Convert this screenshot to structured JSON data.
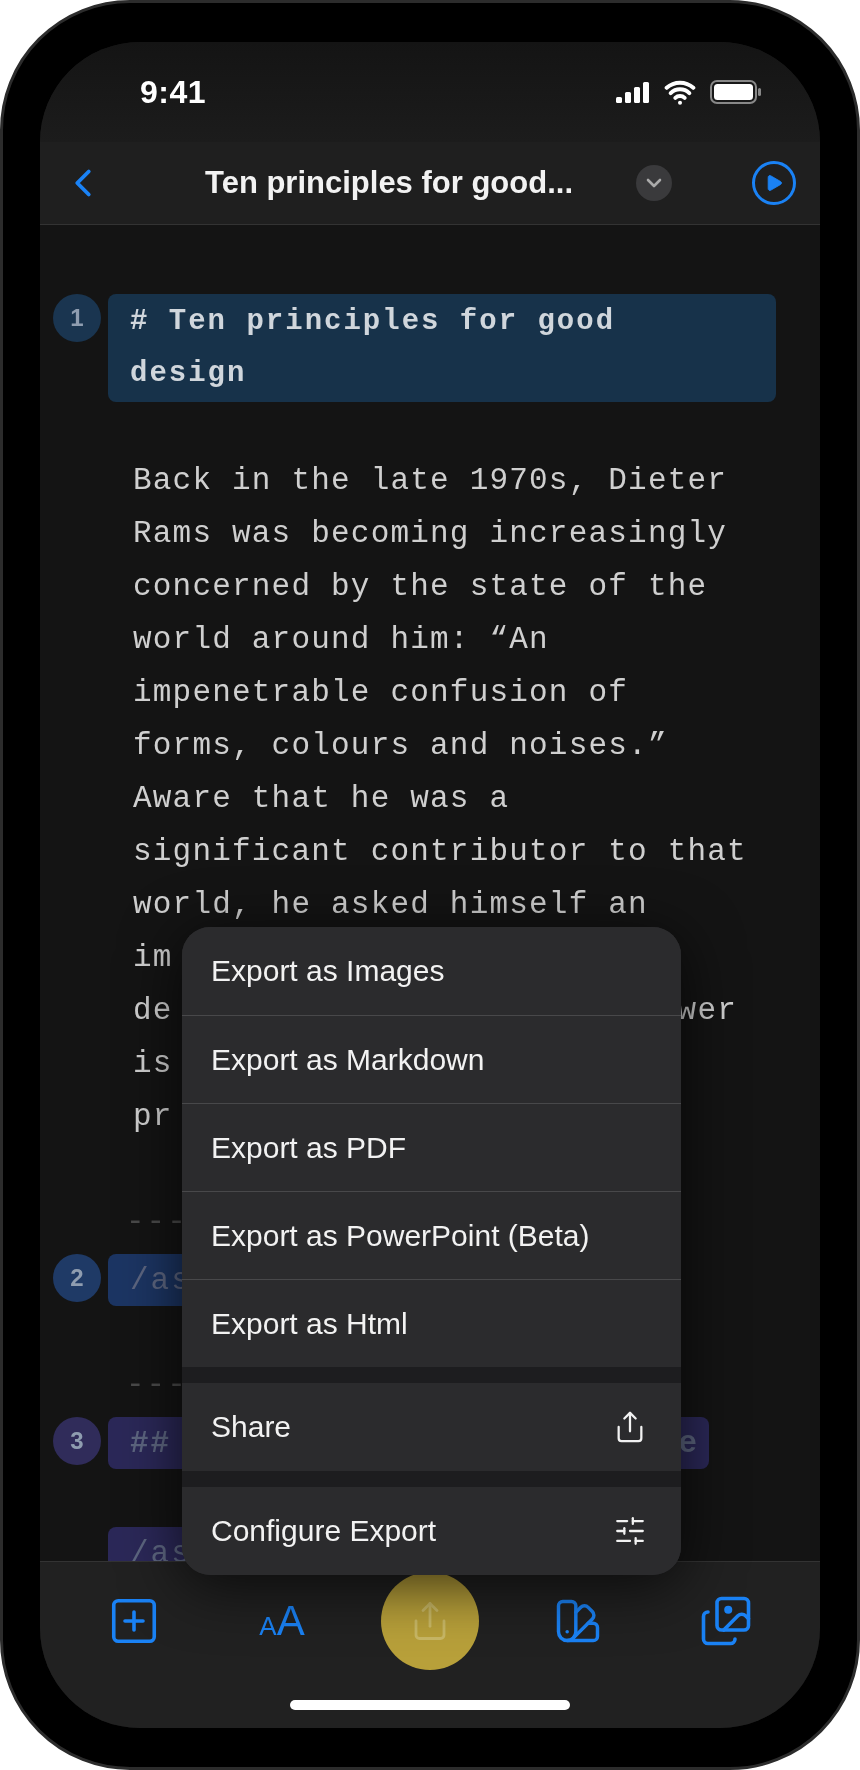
{
  "status_bar": {
    "time": "9:41"
  },
  "nav": {
    "title": "Ten principles for good..."
  },
  "blocks": [
    {
      "kind": "heading",
      "number": "1",
      "lines": [
        "# Ten principles for good",
        "design"
      ]
    },
    {
      "kind": "paragraph",
      "lines": [
        {
          "text": "Back in the late 1970s, Dieter"
        },
        {
          "text": "Rams was becoming increasingly"
        },
        {
          "text": "concerned by the state of the"
        },
        {
          "text": "world around him: “An"
        },
        {
          "text": "impenetrable confusion of"
        },
        {
          "text": "forms, colours and noises.”"
        },
        {
          "text": "Aware that he was a"
        },
        {
          "text": "significant contributor to that"
        },
        {
          "text": "world, he asked himself an"
        },
        {
          "text": "im"
        },
        {
          "text": "de",
          "tail": "wer"
        },
        {
          "text": "is"
        },
        {
          "text": "pr"
        }
      ]
    },
    {
      "kind": "rule",
      "text": "---"
    },
    {
      "kind": "asset",
      "number": "2",
      "text": "/as"
    },
    {
      "kind": "rule",
      "text": "---"
    },
    {
      "kind": "subheading",
      "number": "3",
      "text": "##",
      "tail": "e"
    },
    {
      "kind": "asset",
      "text": "/as"
    }
  ],
  "menu": {
    "groups": [
      {
        "items": [
          {
            "label": "Export as Images",
            "kind": "plain"
          },
          {
            "label": "Export as Markdown",
            "kind": "plain"
          },
          {
            "label": "Export as PDF",
            "kind": "plain"
          },
          {
            "label": "Export as PowerPoint (Beta)",
            "kind": "plain"
          },
          {
            "label": "Export as Html",
            "kind": "plain"
          }
        ]
      },
      {
        "items": [
          {
            "label": "Share",
            "kind": "share"
          }
        ]
      },
      {
        "items": [
          {
            "label": "Configure Export",
            "kind": "configure"
          }
        ]
      }
    ]
  },
  "toolbar": [
    {
      "kind": "add",
      "selected": false
    },
    {
      "kind": "text-size",
      "small": "A",
      "large": "A",
      "selected": false
    },
    {
      "kind": "export",
      "selected": true
    },
    {
      "kind": "themes",
      "selected": false
    },
    {
      "kind": "media",
      "selected": false
    }
  ]
}
